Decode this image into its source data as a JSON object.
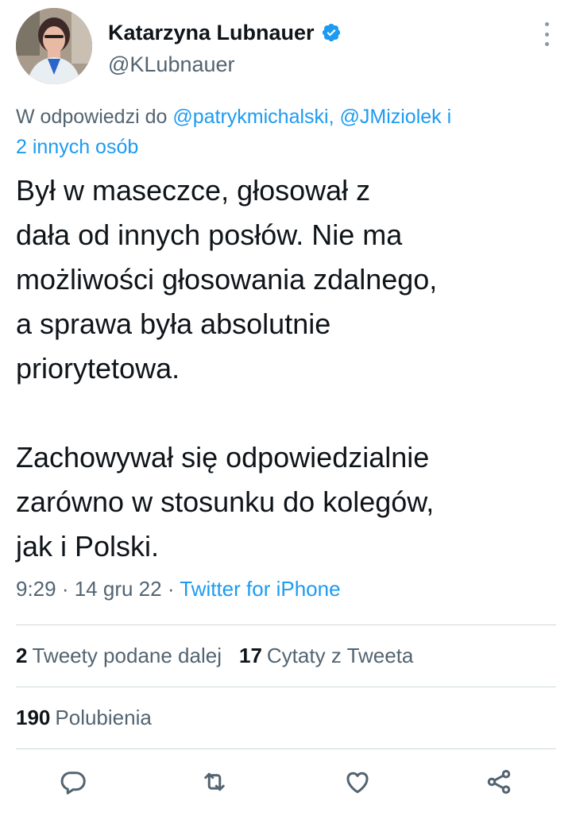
{
  "author": {
    "name": "Katarzyna Lubnauer",
    "handle": "@KLubnauer",
    "verified_color": "#1d9bf0"
  },
  "reply_to": {
    "prefix": "W odpowiedzi do",
    "user1": "@patrykmichalski,",
    "user2": "@JMiziolek",
    "and": "i",
    "others": "2 innych osób"
  },
  "tweet": {
    "text": "Był w maseczce, głosował z\ndała od innych posłów. Nie ma\nmożliwości głosowania zdalnego,\na sprawa była absolutnie\npriorytetowa.\n\nZachowywał się odpowiedzialnie\nzarówno w stosunku do kolegów,\njak i Polski."
  },
  "meta": {
    "time": "9:29",
    "sep1": " · ",
    "date": "14 gru 22",
    "sep2": " · ",
    "source": "Twitter for iPhone"
  },
  "stats": {
    "retweets_count": "2",
    "retweets_label": "Tweety podane dalej",
    "quotes_count": "17",
    "quotes_label": "Cytaty z Tweeta",
    "likes_count": "190",
    "likes_label": "Polubienia"
  },
  "icons": {
    "reply": "reply-icon",
    "retweet": "retweet-icon",
    "like": "heart-icon",
    "share": "share-icon",
    "more": "more-icon",
    "verified": "verified-icon"
  },
  "colors": {
    "link": "#1d9bf0",
    "secondary_text": "#536471",
    "primary_text": "#0f1419",
    "divider": "#cfd9de"
  }
}
